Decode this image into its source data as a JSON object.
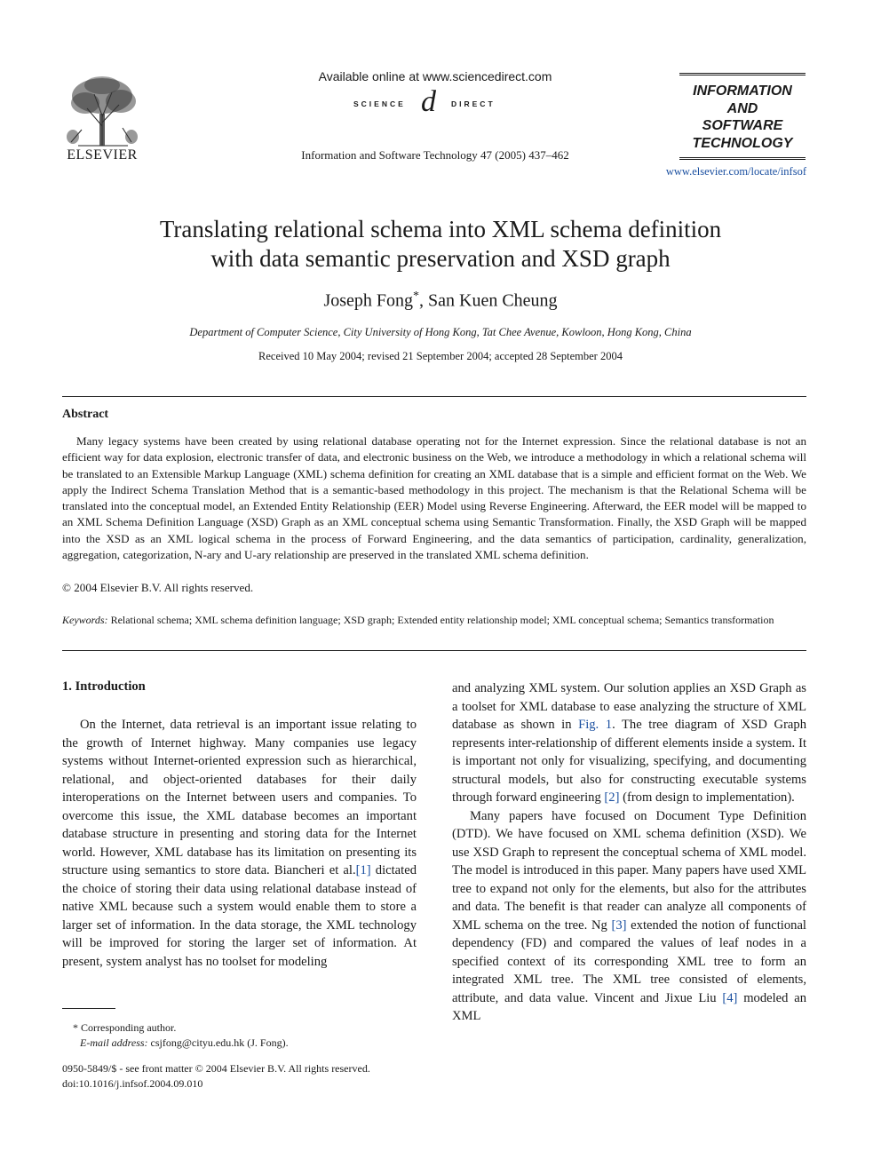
{
  "header": {
    "publisher_logo_icon": "elsevier-tree-logo",
    "publisher_name": "ELSEVIER",
    "available_online": "Available online at www.sciencedirect.com",
    "sciencedirect_left": "SCIENCE",
    "sciencedirect_mark": "d",
    "sciencedirect_right": "DIRECT",
    "journal_reference": "Information and Software Technology 47 (2005) 437–462",
    "journal_logo_lines": [
      "INFORMATION",
      "AND",
      "SOFTWARE",
      "TECHNOLOGY"
    ],
    "journal_url": "www.elsevier.com/locate/infsof"
  },
  "article": {
    "title_line1": "Translating relational schema into XML schema definition",
    "title_line2": "with data semantic preservation and XSD graph",
    "author1": "Joseph Fong",
    "author1_mark": "*",
    "author_sep": ", ",
    "author2": "San Kuen Cheung",
    "affiliation": "Department of Computer Science, City University of Hong Kong, Tat Chee Avenue, Kowloon, Hong Kong, China",
    "dates": "Received 10 May 2004; revised 21 September 2004; accepted 28 September 2004"
  },
  "abstract": {
    "heading": "Abstract",
    "body": "Many legacy systems have been created by using relational database operating not for the Internet expression. Since the relational database is not an efficient way for data explosion, electronic transfer of data, and electronic business on the Web, we introduce a methodology in which a relational schema will be translated to an Extensible Markup Language (XML) schema definition for creating an XML database that is a simple and efficient format on the Web. We apply the Indirect Schema Translation Method that is a semantic-based methodology in this project. The mechanism is that the Relational Schema will be translated into the conceptual model, an Extended Entity Relationship (EER) Model using Reverse Engineering. Afterward, the EER model will be mapped to an XML Schema Definition Language (XSD) Graph as an XML conceptual schema using Semantic Transformation. Finally, the XSD Graph will be mapped into the XSD as an XML logical schema in the process of Forward Engineering, and the data semantics of participation, cardinality, generalization, aggregation, categorization, N-ary and U-ary relationship are preserved in the translated XML schema definition.",
    "copyright": "© 2004 Elsevier B.V. All rights reserved.",
    "keywords_label": "Keywords:",
    "keywords": "Relational schema; XML schema definition language; XSD graph; Extended entity relationship model; XML conceptual schema; Semantics transformation"
  },
  "introduction": {
    "heading": "1. Introduction",
    "left_p1_a": "On the Internet, data retrieval is an important issue relating to the growth of Internet highway. Many companies use legacy systems without Internet-oriented expression such as hierarchical, relational, and object-oriented databases for their daily interoperations on the Internet between users and companies. To overcome this issue, the XML database becomes an important database structure in presenting and storing data for the Internet world. However, XML database has its limitation on presenting its structure using semantics to store data. Biancheri et al.",
    "ref1": "[1]",
    "left_p1_b": " dictated the choice of storing their data using relational database instead of native XML because such a system would enable them to store a larger set of information. In the data storage, the XML technology will be improved for storing the larger set of information. At present, system analyst has no toolset for modeling",
    "right_p1_a": "and analyzing XML system. Our solution applies an XSD Graph as a toolset for XML database to ease analyzing the structure of XML database as shown in ",
    "fig1": "Fig. 1",
    "right_p1_b": ". The tree diagram of XSD Graph represents inter-relationship of different elements inside a system. It is important not only for visualizing, specifying, and documenting structural models, but also for constructing executable systems through forward engineering ",
    "ref2": "[2]",
    "right_p1_c": " (from design to implementation).",
    "right_p2_a": "Many papers have focused on Document Type Definition (DTD). We have focused on XML schema definition (XSD). We use XSD Graph to represent the conceptual schema of XML model. The model is introduced in this paper. Many papers have used XML tree to expand not only for the elements, but also for the attributes and data. The benefit is that reader can analyze all components of XML schema on the tree. Ng ",
    "ref3": "[3]",
    "right_p2_b": " extended the notion of functional dependency (FD) and compared the values of leaf nodes in a specified context of its corresponding XML tree to form an integrated XML tree. The XML tree consisted of elements, attribute, and data value. Vincent and Jixue Liu ",
    "ref4": "[4]",
    "right_p2_c": " modeled an XML"
  },
  "footnote": {
    "mark": "*",
    "corresponding": "Corresponding author.",
    "email_label": "E-mail address:",
    "email": "csjfong@cityu.edu.hk (J. Fong)."
  },
  "front_matter": {
    "issn_line": "0950-5849/$ - see front matter © 2004 Elsevier B.V. All rights reserved.",
    "doi": "doi:10.1016/j.infsof.2004.09.010"
  }
}
